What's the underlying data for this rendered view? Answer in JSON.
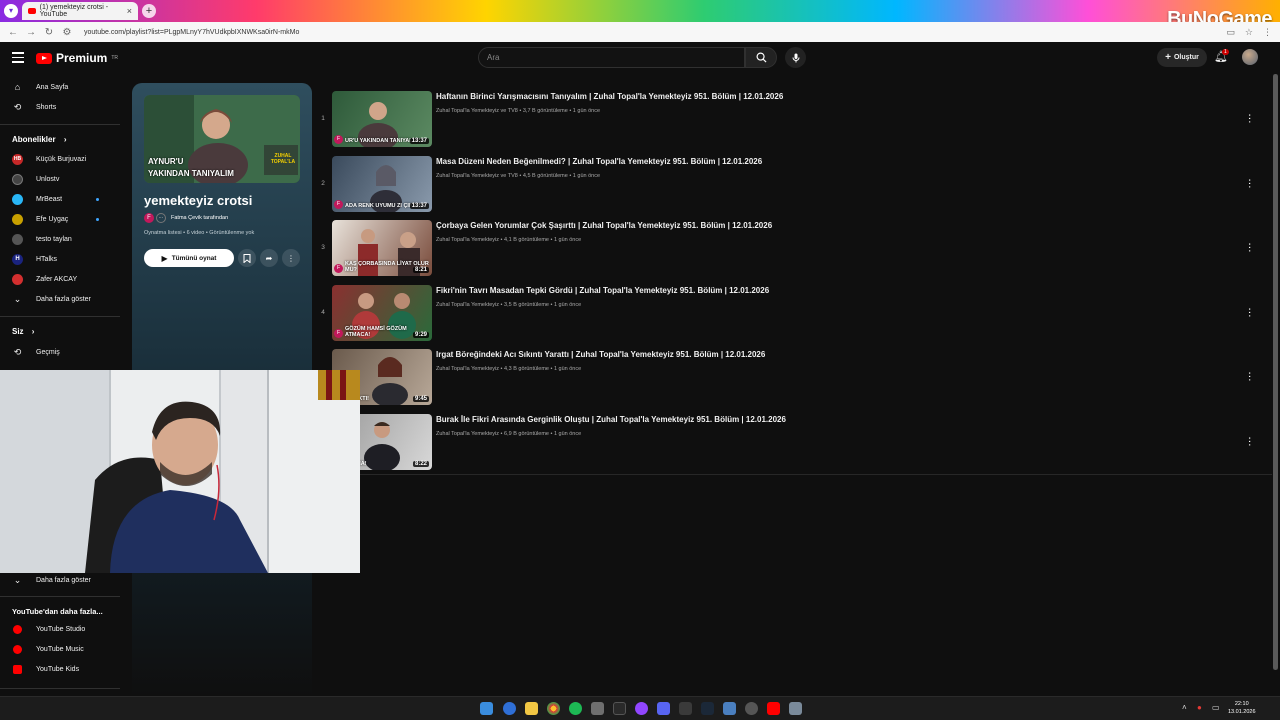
{
  "browser": {
    "tab_title": "(1) yemekteyiz crotsi - YouTube",
    "url": "youtube.com/playlist?list=PLgpMLnyY7hVUdkpbIXNWKsa0irN-mkMo",
    "brand_watermark": "BuNoGame"
  },
  "header": {
    "logo_text": "Premium",
    "logo_sup": "TR",
    "search_placeholder": "Ara",
    "create_label": "Oluştur",
    "notification_count": "1"
  },
  "sidebar": {
    "main": [
      {
        "label": "Ana Sayfa",
        "icon": "home-icon"
      },
      {
        "label": "Shorts",
        "icon": "shorts-icon"
      }
    ],
    "subscriptions_header": "Abonelikler",
    "subscriptions": [
      {
        "label": "Küçük Burjuvazi",
        "color": "#c62828",
        "badge": "HB",
        "new": false
      },
      {
        "label": "Unlostv",
        "color": "#444444",
        "badge": "",
        "new": false
      },
      {
        "label": "MrBeast",
        "color": "#29b6f6",
        "badge": "",
        "new": true
      },
      {
        "label": "Efe Uygaç",
        "color": "#c8a000",
        "badge": "",
        "new": true
      },
      {
        "label": "testo taylan",
        "color": "#555555",
        "badge": "",
        "new": false
      },
      {
        "label": "HTalks",
        "color": "#1a237e",
        "badge": "H",
        "new": false
      },
      {
        "label": "Zafer AKCAY",
        "color": "#d32f2f",
        "badge": "",
        "new": false
      }
    ],
    "show_more": "Daha fazla göster",
    "you_header": "Siz",
    "history": "Geçmiş",
    "show_more_2": "Daha fazla göster",
    "more_from_header": "YouTube'dan daha fazla...",
    "more_from": [
      {
        "label": "YouTube Studio"
      },
      {
        "label": "YouTube Music"
      },
      {
        "label": "YouTube Kids"
      }
    ]
  },
  "playlist": {
    "title": "yemekteyiz crotsi",
    "owner": "Fatma Çevik tarafından",
    "owner_initial": "F",
    "meta": "Oynatma listesi • 6 video • Görüntülenme yok",
    "play_all": "Tümünü oynat",
    "thumb_caption_1": "AYNUR'U",
    "thumb_caption_2": "YAKINDAN TANIYALIM",
    "thumb_logo": "ZUHAL TOPAL'LA"
  },
  "videos": [
    {
      "index": "1",
      "title": "Haftanın Birinci Yarışmacısını Tanıyalım | Zuhal Topal'la Yemekteyiz 951. Bölüm | 12.01.2026",
      "channel": "Zuhal Topal'la Yemekteyiz ve TV8",
      "views": "3,7 B görüntüleme",
      "age": "1 gün önce",
      "duration": "13:37",
      "caption": "UR'U YAKINDAN TANIYALIM",
      "bg": "#3e6b47"
    },
    {
      "index": "2",
      "title": "Masa Düzeni Neden Beğenilmedi? | Zuhal Topal'la Yemekteyiz 951. Bölüm | 12.01.2026",
      "channel": "Zuhal Topal'la Yemekteyiz ve TV8",
      "views": "4,5 B görüntüleme",
      "age": "1 gün önce",
      "duration": "13:37",
      "caption": "ADA RENK UYUMU ZI ÇIKTI!",
      "bg": "#4a5a6e"
    },
    {
      "index": "3",
      "title": "Çorbaya Gelen Yorumlar Çok Şaşırttı | Zuhal Topal'la Yemekteyiz 951. Bölüm | 12.01.2026",
      "channel": "Zuhal Topal'la Yemekteyiz",
      "views": "4,1 B görüntüleme",
      "age": "1 gün önce",
      "duration": "8:21",
      "caption": "KAŞ ÇORBASINDA LİYAT OLUR MU?",
      "bg": "#8a5a48"
    },
    {
      "index": "4",
      "title": "Fikri'nin Tavrı Masadan Tepki Gördü | Zuhal Topal'la Yemekteyiz 951. Bölüm | 12.01.2026",
      "channel": "Zuhal Topal'la Yemekteyiz",
      "views": "3,5 B görüntüleme",
      "age": "1 gün önce",
      "duration": "9:29",
      "caption": "GÖZÜM HAMSİ GÖZÜM ATMACA!",
      "bg": "#6b3e3a"
    },
    {
      "index": "5",
      "title": "Irgat Böreğindeki Acı Sıkıntı Yarattı | Zuhal Topal'la Yemekteyiz 951. Bölüm | 12.01.2026",
      "channel": "Zuhal Topal'la Yemekteyiz",
      "views": "4,3 B görüntüleme",
      "age": "1 gün önce",
      "duration": "9:45",
      "caption": "ACISI YAKTI!",
      "bg": "#7a6a5c"
    },
    {
      "index": "6",
      "title": "Burak İle Fikri Arasında Gerginlik Oluştu | Zuhal Topal'la Yemekteyiz 951. Bölüm | 12.01.2026",
      "channel": "Zuhal Topal'la Yemekteyiz",
      "views": "6,9 B görüntüleme",
      "age": "1 gün önce",
      "duration": "8:22",
      "caption": "NA SOKMA!",
      "bg": "#8e8e8e"
    }
  ],
  "taskbar": {
    "time": "22:10",
    "date": "13.01.2026"
  }
}
